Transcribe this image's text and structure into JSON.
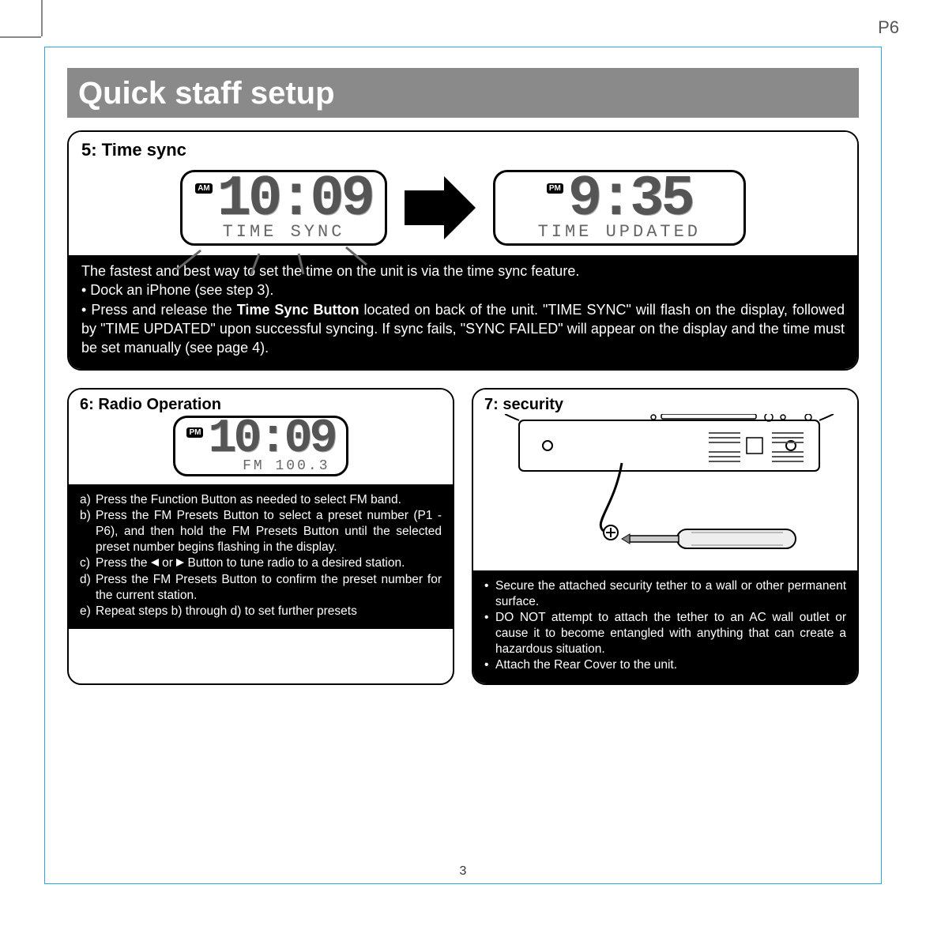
{
  "page_corner": "P6",
  "title": "Quick staff setup",
  "footer_page": "3",
  "section5": {
    "heading": "5: Time sync",
    "lcd_left": {
      "ampm": "AM",
      "time": "10:09",
      "label": "TIME SYNC"
    },
    "lcd_right": {
      "ampm": "PM",
      "time": "9:35",
      "label": "TIME UPDATED"
    },
    "body_line1": "The fastest and best way to set the time on the unit is via the time sync feature.",
    "body_bullet1": "• Dock an iPhone (see step 3).",
    "body_bullet2a": "• Press and release the ",
    "body_bullet2_bold": "Time Sync Button",
    "body_bullet2b": " located on back of the unit. \"TIME SYNC\" will flash on the display, followed by \"TIME UPDATED\" upon successful syncing. If sync fails, \"SYNC FAILED\"  will appear on the display and the time must be set manually (see page 4)."
  },
  "section6": {
    "heading": "6: Radio Operation",
    "lcd": {
      "ampm": "PM",
      "time": "10:09",
      "label": "FM 100.3"
    },
    "items": {
      "a_pre": "Press the ",
      "a_bold": "Function Button",
      "a_post": " as needed to select FM band.",
      "b_pre": "Press the ",
      "b_bold1": "FM Presets Button",
      "b_mid": " to select a preset number (P1 - P6), and then hold the ",
      "b_bold2": "FM Presets Button",
      "b_post": " until the selected preset number begins flashing in the display.",
      "c_pre": "Press the ",
      "c_mid": " or ",
      "c_bold": "Button",
      "c_post": " to tune radio to a desired station.",
      "d_pre": "Press the ",
      "d_bold": "FM Presets Button",
      "d_post": " to confirm the preset number for the current station.",
      "e": "Repeat steps b) through d) to set further presets"
    }
  },
  "section7": {
    "heading": "7: security",
    "bullets": {
      "b1": "Secure the attached security tether to a wall or other permanent surface.",
      "b2": "DO NOT attempt to attach the tether to an AC wall outlet or cause it to become entangled with anything that can create a hazardous situation.",
      "b3": "Attach the Rear Cover to  the unit."
    }
  }
}
